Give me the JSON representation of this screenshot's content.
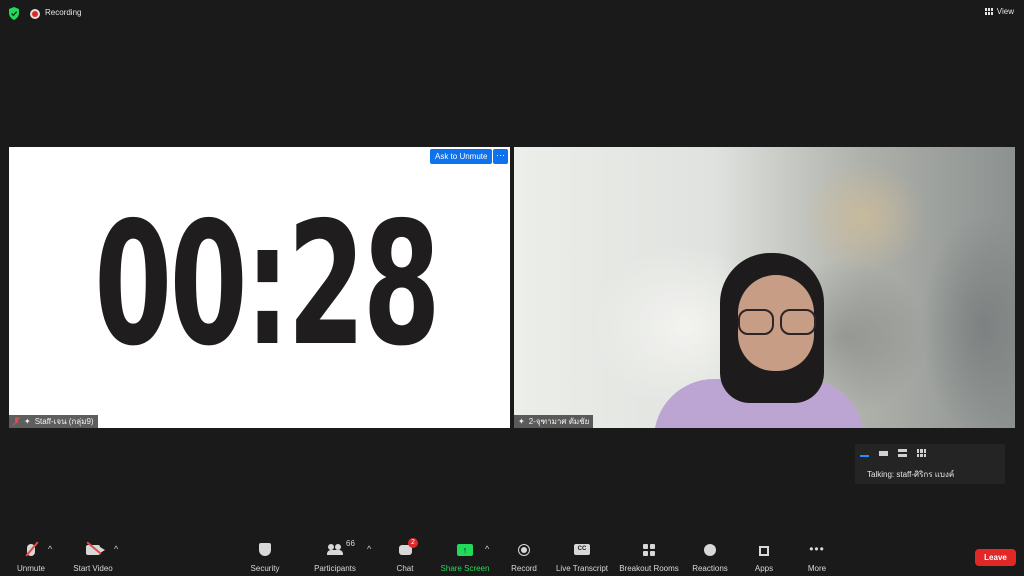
{
  "topbar": {
    "recording_label": "Recording",
    "view_label": "View"
  },
  "tiles": {
    "left": {
      "timer_text": "00:28",
      "ask_unmute_label": "Ask to Unmute",
      "more_label": "···",
      "name": "Staff-เจน (กลุ่ม9)"
    },
    "right": {
      "name": "2-จุฑามาศ ตัมชัย"
    }
  },
  "talking": {
    "label": "Talking:",
    "name": "staff-ศิริกร แบงค์"
  },
  "toolbar": {
    "unmute": "Unmute",
    "start_video": "Start Video",
    "security": "Security",
    "participants": "Participants",
    "participants_count": "66",
    "chat": "Chat",
    "chat_badge": "2",
    "share_screen": "Share Screen",
    "record": "Record",
    "live_transcript": "Live Transcript",
    "cc_glyph": "CC",
    "breakout_rooms": "Breakout Rooms",
    "reactions": "Reactions",
    "apps": "Apps",
    "more": "More",
    "leave": "Leave"
  },
  "colors": {
    "background": "#1a1a1a",
    "accent_blue": "#0e72ed",
    "share_green": "#23d959",
    "leave_red": "#e02828",
    "security_green": "#23d959"
  },
  "icons": [
    "shield-check-icon",
    "recording-icon",
    "view-grid-icon",
    "mic-off-icon",
    "video-off-icon",
    "security-icon",
    "participants-icon",
    "chat-icon",
    "share-screen-icon",
    "record-icon",
    "cc-icon",
    "breakout-rooms-icon",
    "reactions-icon",
    "apps-icon",
    "more-icon"
  ]
}
